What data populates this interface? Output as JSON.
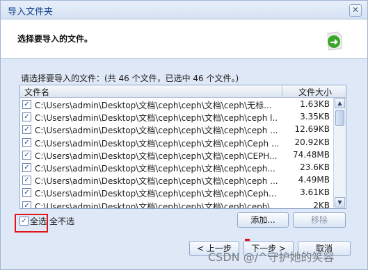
{
  "window": {
    "title": "导入文件夹",
    "close_label": "✕"
  },
  "header": {
    "title": "选择要导入的文件。",
    "icon": "import-arrow-icon"
  },
  "info_text": "请选择要导入的文件：(共 46 个文件，已选中 46 个文件。)",
  "file_list": {
    "columns": {
      "name": "文件名",
      "size": "文件大小"
    },
    "rows": [
      {
        "checked": true,
        "path": "C:\\Users\\admin\\Desktop\\文档\\ceph\\ceph\\文档\\ceph\\无标...",
        "size": "1.63KB"
      },
      {
        "checked": true,
        "path": "C:\\Users\\admin\\Desktop\\文档\\ceph\\ceph\\文档\\ceph\\ceph l...",
        "size": "3.35KB"
      },
      {
        "checked": true,
        "path": "C:\\Users\\admin\\Desktop\\文档\\ceph\\ceph\\文档\\ceph\\ceph ...",
        "size": "12.69KB"
      },
      {
        "checked": true,
        "path": "C:\\Users\\admin\\Desktop\\文档\\ceph\\ceph\\文档\\ceph\\Ceph ...",
        "size": "20.92KB"
      },
      {
        "checked": true,
        "path": "C:\\Users\\admin\\Desktop\\文档\\ceph\\ceph\\文档\\ceph\\CEPH...",
        "size": "74.48MB"
      },
      {
        "checked": true,
        "path": "C:\\Users\\admin\\Desktop\\文档\\ceph\\ceph\\文档\\ceph\\ceph...",
        "size": "23.6KB"
      },
      {
        "checked": true,
        "path": "C:\\Users\\admin\\Desktop\\文档\\ceph\\ceph\\文档\\ceph\\ceph ...",
        "size": "4.49MB"
      },
      {
        "checked": true,
        "path": "C:\\Users\\admin\\Desktop\\文档\\ceph\\ceph\\文档\\ceph\\Ceph...",
        "size": "3.61KB"
      },
      {
        "checked": true,
        "path": "C:\\Users\\admin\\Desktop\\文档\\ceph\\ceph\\文档\\ceph\\ceph\\...",
        "size": "2KB"
      }
    ]
  },
  "selection": {
    "select_all_checked": true,
    "select_all_label": "全选",
    "select_none_label": "全不选"
  },
  "buttons": {
    "add": "添加...",
    "remove": "移除",
    "prev": "< 上一步",
    "next": "下一步 >",
    "cancel": "取消"
  },
  "watermark": "CSDN @/^守护她的笑容",
  "colors": {
    "accent": "#15428b",
    "highlight_box": "#e2141b"
  }
}
